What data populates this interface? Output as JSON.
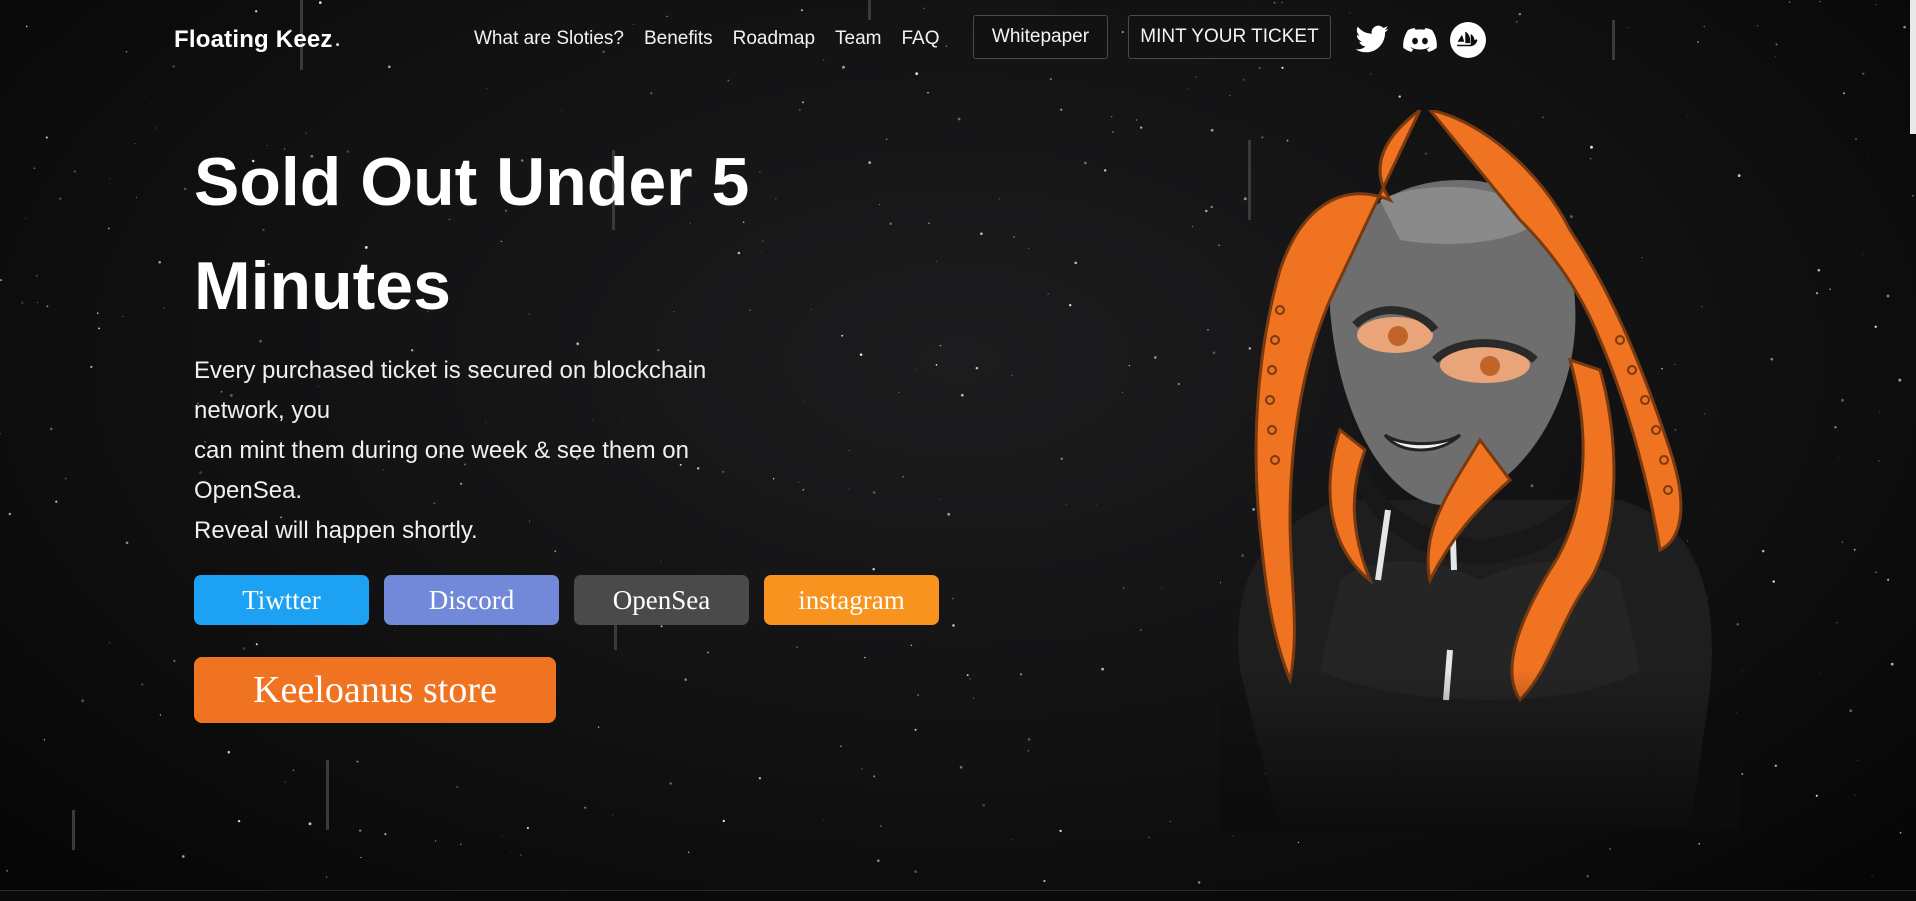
{
  "nav": {
    "brand": "Floating Keez",
    "links": [
      "What are Sloties?",
      "Benefits",
      "Roadmap",
      "Team",
      "FAQ"
    ],
    "whitepaper_label": "Whitepaper",
    "mint_label": "MINT YOUR TICKET",
    "social_icons": [
      "twitter-icon",
      "discord-icon",
      "opensea-icon"
    ]
  },
  "hero": {
    "title": "Sold Out Under 5 Minutes",
    "description": [
      "Every purchased ticket is secured on blockchain network, you",
      "can mint them during one week & see them on OpenSea.",
      "Reveal will happen shortly."
    ],
    "buttons": [
      {
        "label": "Tiwtter",
        "color": "#1da1f2"
      },
      {
        "label": "Discord",
        "color": "#7289da"
      },
      {
        "label": "OpenSea",
        "color": "#4a4a4a"
      },
      {
        "label": "instagram",
        "color": "#f7931e"
      }
    ],
    "store_button": {
      "label": "Keeloanus store",
      "color": "#f07322"
    }
  },
  "colors": {
    "background": "#0c0c0d",
    "accent_orange": "#f07322",
    "nav_border": "#4a4a4a"
  }
}
